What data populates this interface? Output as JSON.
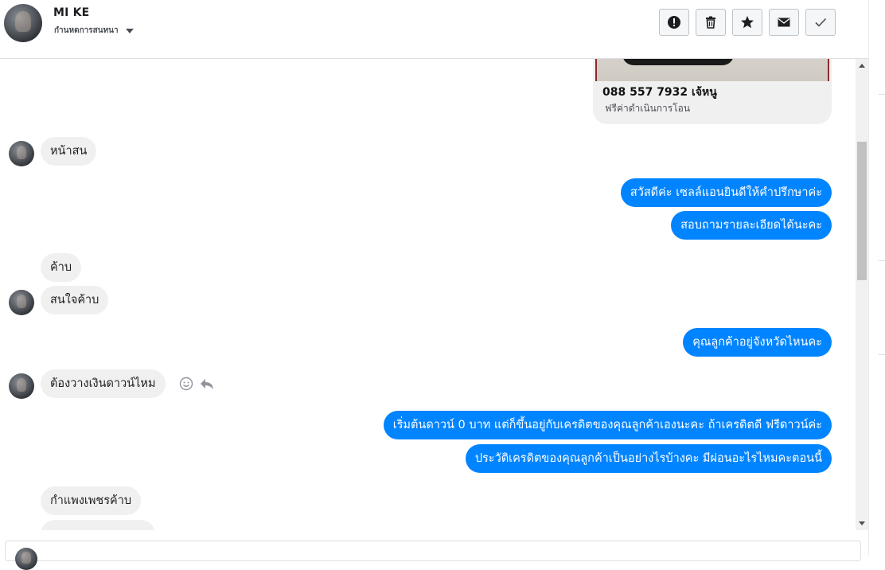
{
  "header": {
    "contact_name": "MI KE",
    "status_label": "กำนหดการสนทนา",
    "actions": [
      {
        "name": "report-button",
        "icon": "alert-icon"
      },
      {
        "name": "delete-button",
        "icon": "trash-icon"
      },
      {
        "name": "star-button",
        "icon": "star-icon"
      },
      {
        "name": "mail-button",
        "icon": "mail-icon"
      },
      {
        "name": "done-button",
        "icon": "check-icon"
      }
    ]
  },
  "card": {
    "title": "088 557 7932 เจ้หนู",
    "subtitle": "ฟรีค่าดำเนินการโอน"
  },
  "messages": [
    {
      "side": "in",
      "text": "หน้าสน"
    },
    {
      "side": "out",
      "text": "สวัสดีค่ะ เซลล์แอนยินดีให้คำปรึกษาค่ะ"
    },
    {
      "side": "out",
      "text": "สอบถามรายละเอียดได้นะคะ"
    },
    {
      "side": "in",
      "text": "ค้าบ"
    },
    {
      "side": "in",
      "text": "สนใจค้าบ"
    },
    {
      "side": "out",
      "text": "คุณลูกค้าอยู่จังหวัดไหนคะ"
    },
    {
      "side": "in",
      "text": "ต้องวางเงินดาวน์ไหม"
    },
    {
      "side": "out",
      "text": "เริ่มต้นดาวน์ 0 บาท แต่ก็ขึ้นอยู่กับเครดิตของคุณลูกค้าเองนะคะ ถ้าเครดิตดี ฟรีดาวน์ค่ะ"
    },
    {
      "side": "out",
      "text": "ประวัติเครดิตของคุณลูกค้าเป็นอย่างไรบ้างคะ มีผ่อนอะไรไหมคะตอนนี้"
    },
    {
      "side": "in",
      "text": "กำแพงเพชรค้าบ"
    }
  ],
  "colors": {
    "outgoing": "#0084ff",
    "incoming": "#f1f0f0",
    "header_border": "#dddfe2"
  }
}
